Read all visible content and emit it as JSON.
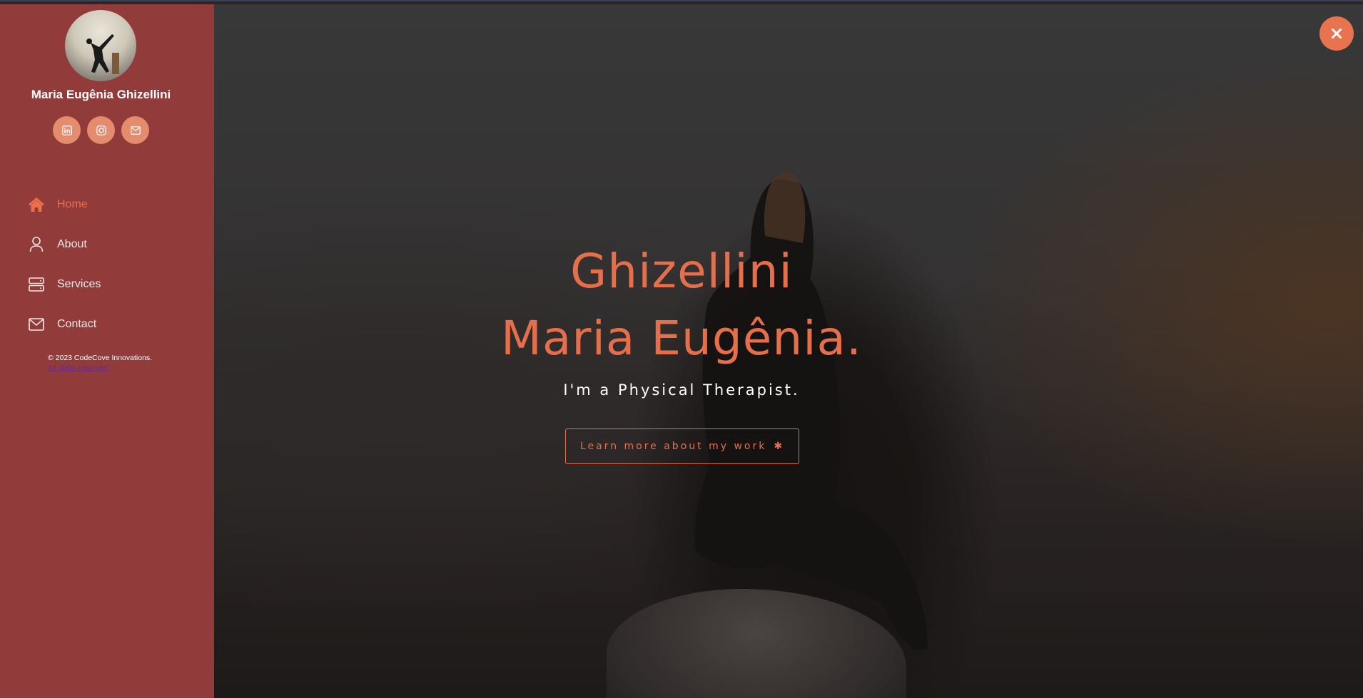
{
  "profile": {
    "name": "Maria Eugênia Ghizellini",
    "avatar": "profile-photo"
  },
  "socials": [
    {
      "name": "linkedin-icon"
    },
    {
      "name": "instagram-icon"
    },
    {
      "name": "email-icon"
    }
  ],
  "nav": {
    "items": [
      {
        "label": "Home",
        "icon": "home-icon",
        "active": true
      },
      {
        "label": "About",
        "icon": "user-icon",
        "active": false
      },
      {
        "label": "Services",
        "icon": "server-icon",
        "active": false
      },
      {
        "label": "Contact",
        "icon": "envelope-icon",
        "active": false
      }
    ]
  },
  "footer": {
    "copyright": "© 2023 CodeCove Innovations.",
    "rights": "All rights reserved"
  },
  "hero": {
    "title_line1": "Ghizellini",
    "title_line2": "Maria Eugênia.",
    "subtitle": "I'm a Physical Therapist.",
    "cta_label": "Learn more about my work",
    "cta_icon": "✱"
  },
  "close": {
    "icon": "close-icon",
    "glyph": "✕"
  },
  "colors": {
    "accent": "#e66f4b",
    "sidebar": "#923b3b",
    "social_bg": "#e58b6e"
  }
}
